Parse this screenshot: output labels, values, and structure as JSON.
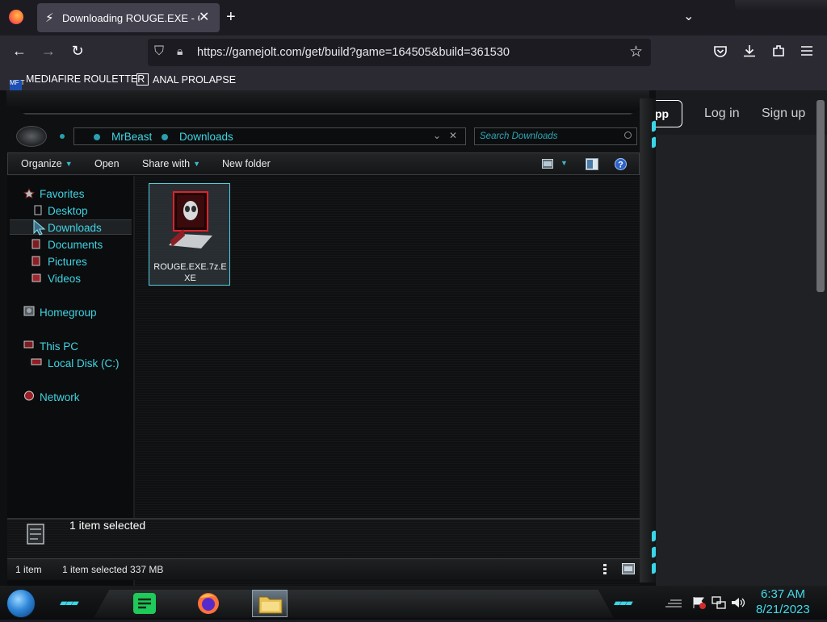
{
  "browser": {
    "tab": {
      "title": "Downloading ROUGE.EXE - Gar",
      "favicon": "gamejolt-bolt-icon"
    },
    "url": "https://gamejolt.com/get/build?game=164505&build=361530",
    "bookmarks": [
      {
        "label": "MEDIAFIRE ROULETTER",
        "icon_text": "MF T"
      },
      {
        "label": "ANAL PROLAPSE",
        "icon_text": ""
      }
    ]
  },
  "site": {
    "app_button": "pp",
    "login": "Log in",
    "signup": "Sign up"
  },
  "explorer": {
    "breadcrumb": [
      "MrBeast",
      "Downloads"
    ],
    "search_placeholder": "Search Downloads",
    "commands": {
      "organize": "Organize",
      "open": "Open",
      "share_with": "Share with",
      "new_folder": "New folder"
    },
    "nav": {
      "favorites": "Favorites",
      "desktop": "Desktop",
      "downloads": "Downloads",
      "documents": "Documents",
      "pictures": "Pictures",
      "videos": "Videos",
      "homegroup": "Homegroup",
      "this_pc": "This PC",
      "local_disk": "Local Disk (C:)",
      "network": "Network"
    },
    "file": {
      "name": "ROUGE.EXE.7z.EXE"
    },
    "details_text": "1 item selected",
    "status": {
      "count": "1 item",
      "selected": "1 item selected  337 MB"
    }
  },
  "taskbar": {
    "time": "6:37 AM",
    "date": "8/21/2023"
  },
  "colors": {
    "accent_cyan": "#3fd4e4",
    "firefox_bg": "#1c1b22",
    "toolbar_bg": "#2b2a33"
  }
}
